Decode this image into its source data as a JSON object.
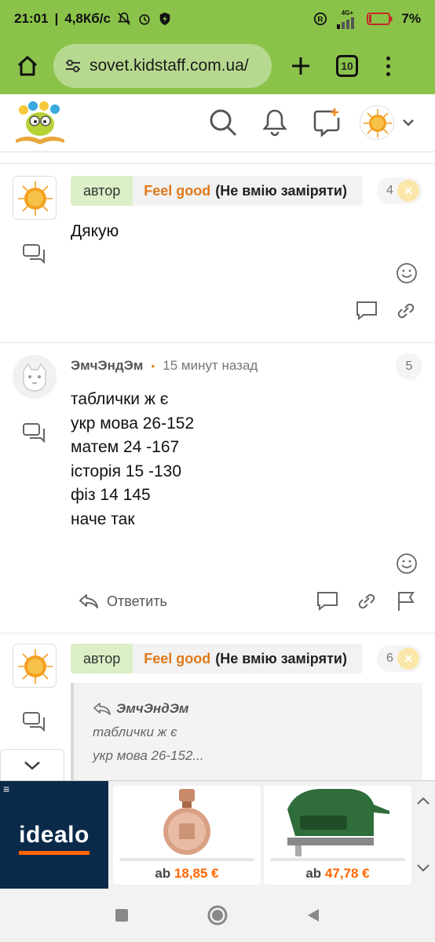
{
  "status_bar": {
    "time": "21:01",
    "network_speed": "4,8Кб/с",
    "network_type": "4G+",
    "battery": "7%"
  },
  "browser": {
    "url": "sovet.kidstaff.com.ua/",
    "tab_count": "10"
  },
  "posts": [
    {
      "author_tag": "автор",
      "author_name": "Feel good",
      "author_status": "(Не вмію заміряти)",
      "number": "4",
      "lines": [
        "Дякую"
      ]
    },
    {
      "nick": "ЭмчЭндЭм",
      "time": "15 минут назад",
      "number": "5",
      "lines": [
        "таблички ж є",
        "укр мова 26-152",
        "матем 24 -167",
        "історія 15 -130",
        "фіз 14 145",
        "наче так"
      ],
      "reply_label": "Ответить"
    },
    {
      "author_tag": "автор",
      "author_name": "Feel good",
      "author_status": "(Не вмію заміряти)",
      "number": "6",
      "quote_author": "ЭмчЭндЭм",
      "quote_lines": [
        "таблички ж є",
        "укр мова 26-152..."
      ]
    }
  ],
  "ad": {
    "brand": "idealo",
    "products": [
      {
        "prefix": "ab",
        "price": "18,85 €"
      },
      {
        "prefix": "ab",
        "price": "47,78 €"
      }
    ]
  },
  "icons": {
    "accent": "#8bc34a",
    "brand_orange": "#e07a1a"
  }
}
